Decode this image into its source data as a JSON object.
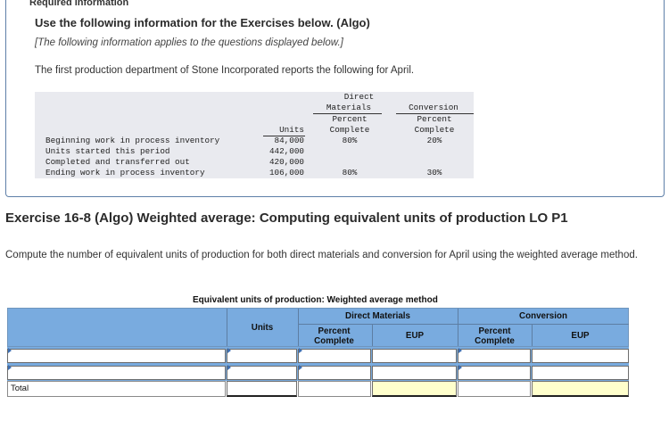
{
  "header": {
    "required_info": "Required information",
    "use_following": "Use the following information for the Exercises below. (Algo)",
    "applies_note": "[The following information applies to the questions displayed below.]",
    "intro": "The first production department of Stone Incorporated reports the following for April."
  },
  "info_table": {
    "col_units": "Units",
    "col_dm": [
      "Direct",
      "Materials",
      "Percent",
      "Complete"
    ],
    "col_conv": [
      "Conversion",
      "Percent",
      "Complete"
    ],
    "rows": [
      {
        "label": "Beginning work in process inventory",
        "units": "84,000",
        "dm": "80%",
        "conv": "20%"
      },
      {
        "label": "Units started this period",
        "units": "442,000",
        "dm": "",
        "conv": ""
      },
      {
        "label": "Completed and transferred out",
        "units": "420,000",
        "dm": "",
        "conv": ""
      },
      {
        "label": "Ending work in process inventory",
        "units": "106,000",
        "dm": "80%",
        "conv": "30%"
      }
    ]
  },
  "exercise": {
    "title": "Exercise 16-8 (Algo) Weighted average: Computing equivalent units of production LO P1",
    "prompt": "Compute the number of equivalent units of production for both direct materials and conversion for April using the weighted average method."
  },
  "grid": {
    "caption": "Equivalent units of production: Weighted average method",
    "units_header": "Units",
    "dm_header": "Direct Materials",
    "conv_header": "Conversion",
    "percent_complete": "Percent Complete",
    "eup": "EUP",
    "total_label": "Total"
  },
  "colors": {
    "header_blue": "#79abdf",
    "highlight_yellow": "#ffffcc",
    "table_gray": "#e9eaef"
  }
}
